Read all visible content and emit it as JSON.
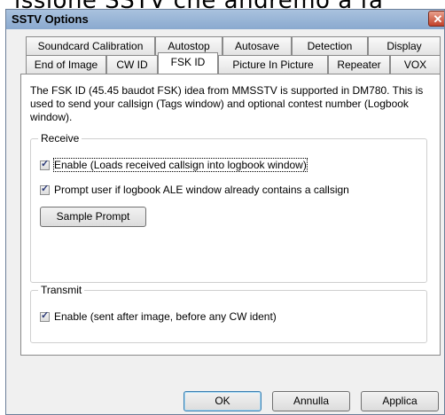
{
  "background": {
    "text": "issione SSTV che andremo a fa"
  },
  "window": {
    "title": "SSTV Options",
    "close_glyph": "✕"
  },
  "tabs": {
    "row1": [
      "Soundcard Calibration",
      "Autostop",
      "Autosave",
      "Detection",
      "Display"
    ],
    "row2": [
      "End of Image",
      "CW ID",
      "FSK ID",
      "Picture In Picture",
      "Repeater",
      "VOX"
    ],
    "selected": "FSK ID"
  },
  "panel": {
    "description": "The FSK ID (45.45 baudot FSK) idea from MMSSTV is supported in DM780. This is used to send your callsign (Tags window) and optional contest number (Logbook window).",
    "receive": {
      "legend": "Receive",
      "enable_label": "Enable (Loads received callsign into logbook window)",
      "enable_checked": true,
      "prompt_label": "Prompt user if logbook ALE window already contains a callsign",
      "prompt_checked": true,
      "sample_button": "Sample Prompt"
    },
    "transmit": {
      "legend": "Transmit",
      "enable_label": "Enable (sent after image, before any CW ident)",
      "enable_checked": true
    }
  },
  "buttons": {
    "ok": "OK",
    "cancel": "Annulla",
    "apply": "Applica"
  },
  "colors": {
    "titlebar": "#a9c2de",
    "close": "#c2412a",
    "checkmark": "#2b3a78",
    "default_button_border": "#3c7fb1"
  }
}
